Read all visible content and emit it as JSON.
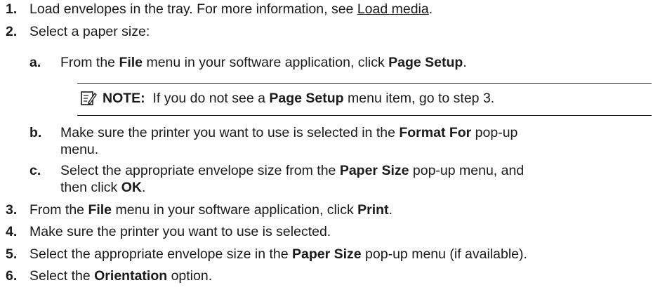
{
  "steps": [
    {
      "num": "1.",
      "pre": "Load envelopes in the tray. For more information, see ",
      "link": "Load media",
      "post": "."
    },
    {
      "num": "2.",
      "text": "Select a paper size:"
    },
    {
      "num": "3.",
      "pre": "From the ",
      "b1": "File",
      "mid": " menu in your software application, click ",
      "b2": "Print",
      "post": "."
    },
    {
      "num": "4.",
      "text": "Make sure the printer you want to use is selected."
    },
    {
      "num": "5.",
      "pre": "Select the appropriate envelope size in the ",
      "b1": "Paper Size",
      "post": " pop-up menu (if available)."
    },
    {
      "num": "6.",
      "pre": "Select the ",
      "b1": "Orientation",
      "post": " option."
    }
  ],
  "substeps": [
    {
      "letter": "a",
      "pre": "From the ",
      "b1": "File",
      "mid": " menu in your software application, click ",
      "b2": "Page Setup",
      "post": "."
    },
    {
      "letter": "b",
      "pre": "Make sure the printer you want to use is selected in the ",
      "b1": "Format For",
      "post": " pop-up",
      "line2": "menu."
    },
    {
      "letter": "c",
      "pre": "Select the appropriate envelope size from the ",
      "b1": "Paper Size",
      "post": " pop-up menu, and",
      "line2_pre": "then click ",
      "line2_b": "OK",
      "line2_post": "."
    }
  ],
  "note": {
    "label": "NOTE:",
    "pre": "If you do not see a ",
    "b1": "Page Setup",
    "post": " menu item, go to step 3."
  }
}
